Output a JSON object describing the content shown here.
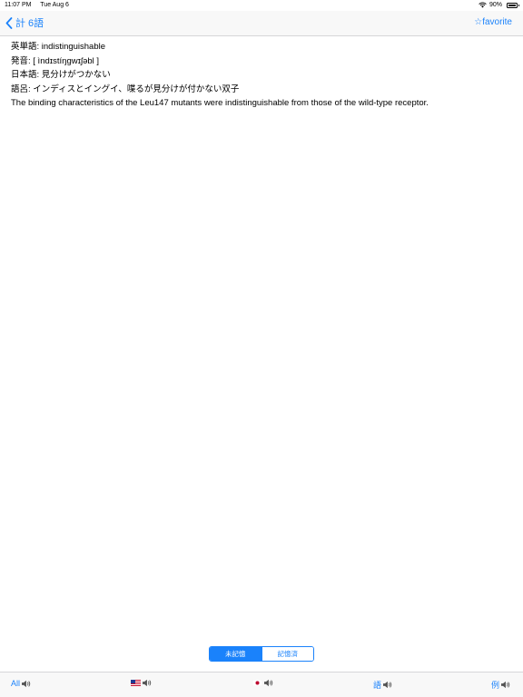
{
  "status": {
    "time": "11:07 PM",
    "date": "Tue Aug 6",
    "battery": "90%"
  },
  "nav": {
    "back_label": "計 6語",
    "favorite_label": "☆favorite"
  },
  "entry": {
    "english": "英単語: indistinguishable",
    "pronunciation": "発音: [ ìndɪstíŋgwɪʃəbl ]",
    "japanese": "日本語: 見分けがつかない",
    "mnemonic": "語呂: インディスとイングイ、喋るが見分けが付かない双子",
    "example": "The binding characteristics of the Leu147 mutants were indistinguishable from those of the wild-type receptor."
  },
  "segment": {
    "items": [
      "未記憶",
      "記憶済"
    ],
    "selected_index": 0
  },
  "toolbar": {
    "all_label": "All",
    "word_label": "語",
    "example_label": "例"
  },
  "colors": {
    "accent": "#1a82fb"
  }
}
